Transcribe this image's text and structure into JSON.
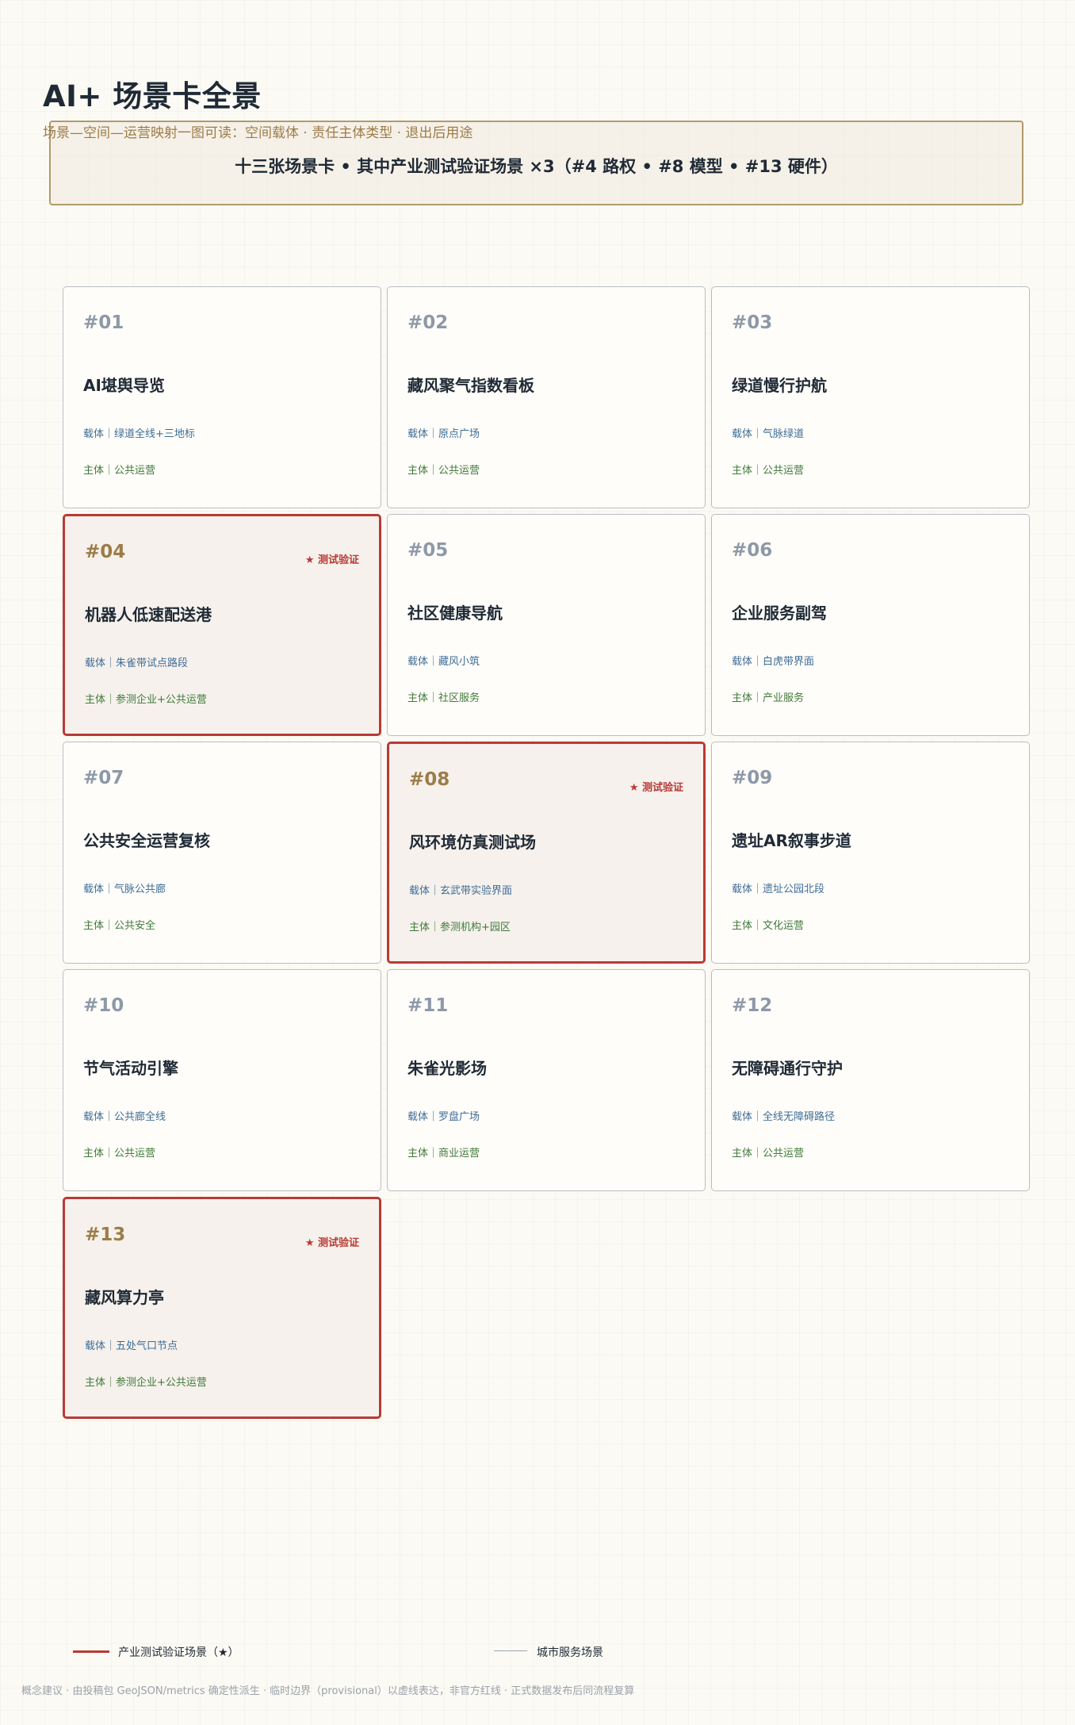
{
  "page": {
    "title": "AI+ 场景卡全景",
    "subtitle": "场景—空间—运营映射一图可读：空间载体 · 责任主体类型 · 退出后用途",
    "summary": "十三张场景卡 • 其中产业测试验证场景 ×3（#4 路权 • #8 模型 • #13 硬件）"
  },
  "colors": {
    "accent_red": "#b93a35",
    "gold": "#9c7c48",
    "carrier_blue": "#3e6d98",
    "owner_green": "#3f7a3a",
    "muted_gray": "#8d99a8"
  },
  "cards": [
    {
      "num": "#01",
      "title": "AI堪舆导览",
      "carrier": "载体｜绿道全线+三地标",
      "owner": "主体｜公共运营",
      "tag": "",
      "test": false
    },
    {
      "num": "#02",
      "title": "藏风聚气指数看板",
      "carrier": "载体｜原点广场",
      "owner": "主体｜公共运营",
      "tag": "",
      "test": false
    },
    {
      "num": "#03",
      "title": "绿道慢行护航",
      "carrier": "载体｜气脉绿道",
      "owner": "主体｜公共运营",
      "tag": "",
      "test": false
    },
    {
      "num": "#04",
      "title": "机器人低速配送港",
      "carrier": "载体｜朱雀带试点路段",
      "owner": "主体｜参测企业+公共运营",
      "tag": "★ 测试验证",
      "test": true
    },
    {
      "num": "#05",
      "title": "社区健康导航",
      "carrier": "载体｜藏风小筑",
      "owner": "主体｜社区服务",
      "tag": "",
      "test": false
    },
    {
      "num": "#06",
      "title": "企业服务副驾",
      "carrier": "载体｜白虎带界面",
      "owner": "主体｜产业服务",
      "tag": "",
      "test": false
    },
    {
      "num": "#07",
      "title": "公共安全运营复核",
      "carrier": "载体｜气脉公共廊",
      "owner": "主体｜公共安全",
      "tag": "",
      "test": false
    },
    {
      "num": "#08",
      "title": "风环境仿真测试场",
      "carrier": "载体｜玄武带实验界面",
      "owner": "主体｜参测机构+园区",
      "tag": "★ 测试验证",
      "test": true
    },
    {
      "num": "#09",
      "title": "遗址AR叙事步道",
      "carrier": "载体｜遗址公园北段",
      "owner": "主体｜文化运营",
      "tag": "",
      "test": false
    },
    {
      "num": "#10",
      "title": "节气活动引擎",
      "carrier": "载体｜公共廊全线",
      "owner": "主体｜公共运营",
      "tag": "",
      "test": false
    },
    {
      "num": "#11",
      "title": "朱雀光影场",
      "carrier": "载体｜罗盘广场",
      "owner": "主体｜商业运营",
      "tag": "",
      "test": false
    },
    {
      "num": "#12",
      "title": "无障碍通行守护",
      "carrier": "载体｜全线无障碍路径",
      "owner": "主体｜公共运营",
      "tag": "",
      "test": false
    },
    {
      "num": "#13",
      "title": "藏风算力亭",
      "carrier": "载体｜五处气口节点",
      "owner": "主体｜参测企业+公共运营",
      "tag": "★ 测试验证",
      "test": true
    }
  ],
  "legend": {
    "test_label": "产业测试验证场景（★）",
    "service_label": "城市服务场景"
  },
  "footnote": "概念建议 · 由投稿包 GeoJSON/metrics 确定性派生 · 临时边界（provisional）以虚线表达，非官方红线 · 正式数据发布后同流程复算"
}
